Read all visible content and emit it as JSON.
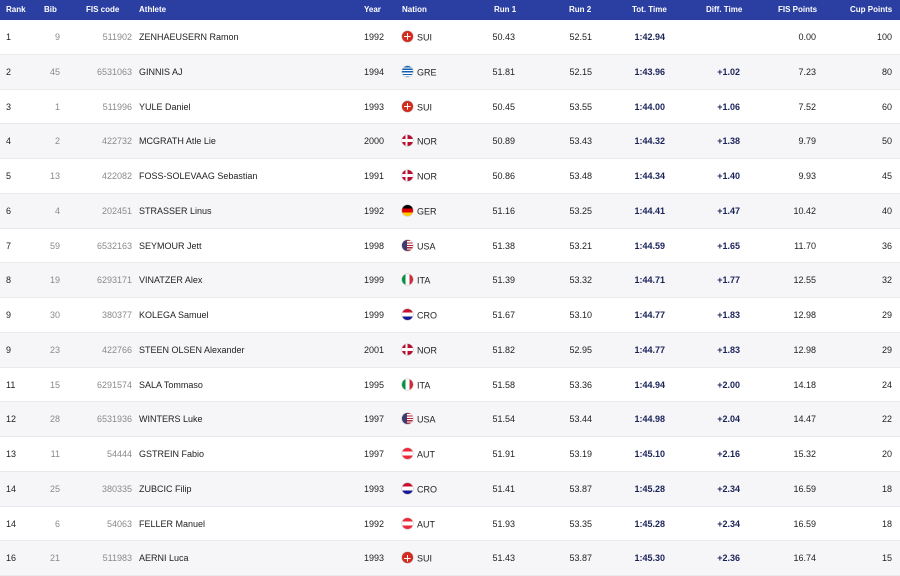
{
  "columns": {
    "rank": "Rank",
    "bib": "Bib",
    "fis_code": "FIS code",
    "athlete": "Athlete",
    "year": "Year",
    "nation": "Nation",
    "run1": "Run 1",
    "run2": "Run 2",
    "tot_time": "Tot. Time",
    "diff_time": "Diff. Time",
    "fis_points": "FIS Points",
    "cup_points": "Cup Points"
  },
  "flag_colors": {
    "SUI": "#d52b1e",
    "GRE": "#0d5eaf",
    "NOR": "#ba0c2f",
    "GER": "#dd0000",
    "USA": "#3c3b6e",
    "ITA": "#009246",
    "CRO": "#c8102e",
    "AUT": "#ed2939"
  },
  "rows": [
    {
      "rank": "1",
      "bib": "9",
      "fis": "511902",
      "athlete": "ZENHAEUSERN Ramon",
      "year": "1992",
      "nation": "SUI",
      "run1": "50.43",
      "run2": "52.51",
      "tot": "1:42.94",
      "diff": "",
      "fisp": "0.00",
      "cup": "100"
    },
    {
      "rank": "2",
      "bib": "45",
      "fis": "6531063",
      "athlete": "GINNIS AJ",
      "year": "1994",
      "nation": "GRE",
      "run1": "51.81",
      "run2": "52.15",
      "tot": "1:43.96",
      "diff": "+1.02",
      "fisp": "7.23",
      "cup": "80"
    },
    {
      "rank": "3",
      "bib": "1",
      "fis": "511996",
      "athlete": "YULE Daniel",
      "year": "1993",
      "nation": "SUI",
      "run1": "50.45",
      "run2": "53.55",
      "tot": "1:44.00",
      "diff": "+1.06",
      "fisp": "7.52",
      "cup": "60"
    },
    {
      "rank": "4",
      "bib": "2",
      "fis": "422732",
      "athlete": "MCGRATH Atle Lie",
      "year": "2000",
      "nation": "NOR",
      "run1": "50.89",
      "run2": "53.43",
      "tot": "1:44.32",
      "diff": "+1.38",
      "fisp": "9.79",
      "cup": "50"
    },
    {
      "rank": "5",
      "bib": "13",
      "fis": "422082",
      "athlete": "FOSS-SOLEVAAG Sebastian",
      "year": "1991",
      "nation": "NOR",
      "run1": "50.86",
      "run2": "53.48",
      "tot": "1:44.34",
      "diff": "+1.40",
      "fisp": "9.93",
      "cup": "45"
    },
    {
      "rank": "6",
      "bib": "4",
      "fis": "202451",
      "athlete": "STRASSER Linus",
      "year": "1992",
      "nation": "GER",
      "run1": "51.16",
      "run2": "53.25",
      "tot": "1:44.41",
      "diff": "+1.47",
      "fisp": "10.42",
      "cup": "40"
    },
    {
      "rank": "7",
      "bib": "59",
      "fis": "6532163",
      "athlete": "SEYMOUR Jett",
      "year": "1998",
      "nation": "USA",
      "run1": "51.38",
      "run2": "53.21",
      "tot": "1:44.59",
      "diff": "+1.65",
      "fisp": "11.70",
      "cup": "36"
    },
    {
      "rank": "8",
      "bib": "19",
      "fis": "6293171",
      "athlete": "VINATZER Alex",
      "year": "1999",
      "nation": "ITA",
      "run1": "51.39",
      "run2": "53.32",
      "tot": "1:44.71",
      "diff": "+1.77",
      "fisp": "12.55",
      "cup": "32"
    },
    {
      "rank": "9",
      "bib": "30",
      "fis": "380377",
      "athlete": "KOLEGA Samuel",
      "year": "1999",
      "nation": "CRO",
      "run1": "51.67",
      "run2": "53.10",
      "tot": "1:44.77",
      "diff": "+1.83",
      "fisp": "12.98",
      "cup": "29"
    },
    {
      "rank": "9",
      "bib": "23",
      "fis": "422766",
      "athlete": "STEEN OLSEN Alexander",
      "year": "2001",
      "nation": "NOR",
      "run1": "51.82",
      "run2": "52.95",
      "tot": "1:44.77",
      "diff": "+1.83",
      "fisp": "12.98",
      "cup": "29"
    },
    {
      "rank": "11",
      "bib": "15",
      "fis": "6291574",
      "athlete": "SALA Tommaso",
      "year": "1995",
      "nation": "ITA",
      "run1": "51.58",
      "run2": "53.36",
      "tot": "1:44.94",
      "diff": "+2.00",
      "fisp": "14.18",
      "cup": "24"
    },
    {
      "rank": "12",
      "bib": "28",
      "fis": "6531936",
      "athlete": "WINTERS Luke",
      "year": "1997",
      "nation": "USA",
      "run1": "51.54",
      "run2": "53.44",
      "tot": "1:44.98",
      "diff": "+2.04",
      "fisp": "14.47",
      "cup": "22"
    },
    {
      "rank": "13",
      "bib": "11",
      "fis": "54444",
      "athlete": "GSTREIN Fabio",
      "year": "1997",
      "nation": "AUT",
      "run1": "51.91",
      "run2": "53.19",
      "tot": "1:45.10",
      "diff": "+2.16",
      "fisp": "15.32",
      "cup": "20"
    },
    {
      "rank": "14",
      "bib": "25",
      "fis": "380335",
      "athlete": "ZUBCIC Filip",
      "year": "1993",
      "nation": "CRO",
      "run1": "51.41",
      "run2": "53.87",
      "tot": "1:45.28",
      "diff": "+2.34",
      "fisp": "16.59",
      "cup": "18"
    },
    {
      "rank": "14",
      "bib": "6",
      "fis": "54063",
      "athlete": "FELLER Manuel",
      "year": "1992",
      "nation": "AUT",
      "run1": "51.93",
      "run2": "53.35",
      "tot": "1:45.28",
      "diff": "+2.34",
      "fisp": "16.59",
      "cup": "18"
    },
    {
      "rank": "16",
      "bib": "21",
      "fis": "511983",
      "athlete": "AERNI Luca",
      "year": "1993",
      "nation": "SUI",
      "run1": "51.43",
      "run2": "53.87",
      "tot": "1:45.30",
      "diff": "+2.36",
      "fisp": "16.74",
      "cup": "15"
    }
  ]
}
